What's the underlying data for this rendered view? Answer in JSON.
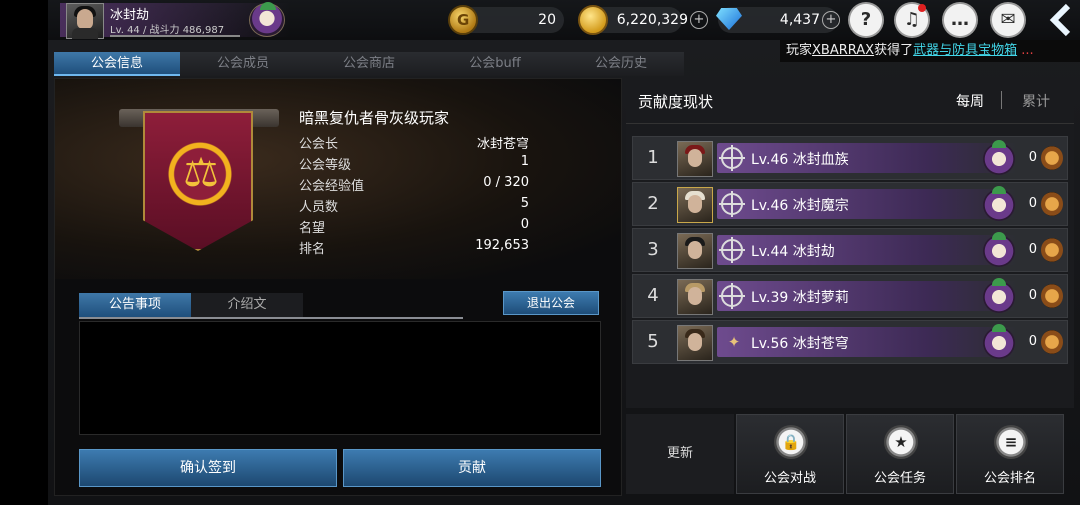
{
  "player": {
    "name": "冰封劫",
    "level_power": "Lv. 44 / 战斗力 486,987"
  },
  "resources": {
    "g_points": "20",
    "g_symbol": "G",
    "gold": "6,220,329",
    "gems": "4,437"
  },
  "ticker": {
    "prefix": "玩家",
    "player": "XBARRAX",
    "middle": "获得了",
    "item": "武器与防具宝物箱",
    "more": "..."
  },
  "tabs": [
    "公会信息",
    "公会成员",
    "公会商店",
    "公会buff",
    "公会历史"
  ],
  "guild": {
    "name": "暗黑复仇者骨灰级玩家",
    "info": [
      {
        "key": "公会长",
        "value": "冰封苍穹"
      },
      {
        "key": "公会等级",
        "value": "1"
      },
      {
        "key": "公会经验值",
        "value": "0 / 320"
      },
      {
        "key": "人员数",
        "value": "5"
      },
      {
        "key": "名望",
        "value": "0"
      },
      {
        "key": "排名",
        "value": "192,653"
      }
    ]
  },
  "subtabs": [
    "公告事项",
    "介绍文"
  ],
  "buttons": {
    "quit": "退出公会",
    "checkin": "确认签到",
    "contribute": "贡献"
  },
  "contribution": {
    "title": "贡献度现状",
    "period_weekly": "每周",
    "period_total": "累计",
    "rows": [
      {
        "rank": "1",
        "name": "Lv.46 冰封血族",
        "value": "0",
        "emblem": "crosshair"
      },
      {
        "rank": "2",
        "name": "Lv.46 冰封魔宗",
        "value": "0",
        "emblem": "crosshair"
      },
      {
        "rank": "3",
        "name": "Lv.44 冰封劫",
        "value": "0",
        "emblem": "crosshair"
      },
      {
        "rank": "4",
        "name": "Lv.39 冰封萝莉",
        "value": "0",
        "emblem": "crosshair"
      },
      {
        "rank": "5",
        "name": "Lv.56 冰封苍穹",
        "value": "0",
        "emblem": "wings"
      }
    ]
  },
  "bottom": {
    "refresh": "更新",
    "war": "公会对战",
    "quest": "公会任务",
    "ranking": "公会排名"
  },
  "colors": {
    "accent_blue": "#3d7bb0",
    "banner_red": "#8e1e3a",
    "row_purple": "#6e4b8e",
    "link_cyan": "#42d6e8"
  }
}
